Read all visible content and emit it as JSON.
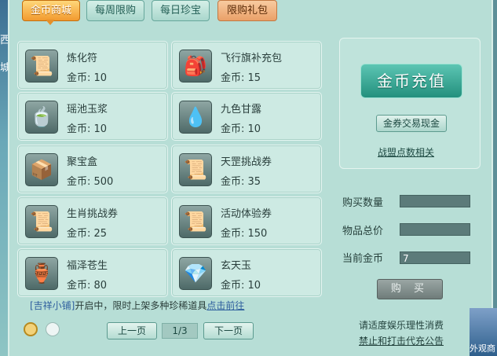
{
  "left_edge_text": [
    "西",
    "城"
  ],
  "tabs": [
    {
      "label": "金币商城",
      "active": true
    },
    {
      "label": "每周限购",
      "active": false
    },
    {
      "label": "每日珍宝",
      "active": false
    },
    {
      "label": "限购礼包",
      "active": false
    }
  ],
  "items": [
    {
      "name": "炼化符",
      "price": "金币: 10",
      "icon": "talisman-icon"
    },
    {
      "name": "飞行旗补充包",
      "price": "金币: 15",
      "icon": "flag-pack-icon"
    },
    {
      "name": "瑶池玉浆",
      "price": "金币: 10",
      "icon": "jade-gourd-icon"
    },
    {
      "name": "九色甘露",
      "price": "金币: 10",
      "icon": "nectar-icon"
    },
    {
      "name": "聚宝盒",
      "price": "金币: 500",
      "icon": "treasure-box-icon"
    },
    {
      "name": "天罡挑战券",
      "price": "金币: 35",
      "icon": "scroll-icon"
    },
    {
      "name": "生肖挑战券",
      "price": "金币: 25",
      "icon": "scroll-icon"
    },
    {
      "name": "活动体验券",
      "price": "金币: 150",
      "icon": "scroll-icon"
    },
    {
      "name": "福泽苍生",
      "price": "金币: 80",
      "icon": "bottle-icon"
    },
    {
      "name": "玄天玉",
      "price": "金币: 10",
      "icon": "jade-gem-icon"
    }
  ],
  "right": {
    "recharge_label": "金币充值",
    "exchange_label": "金券交易现金",
    "alliance_label": "战盟点数相关",
    "qty_label": "购买数量",
    "qty_value": "",
    "total_label": "物品总价",
    "total_value": "",
    "balance_label": "当前金币",
    "balance_value": "7",
    "buy_label": "购 买"
  },
  "promo": {
    "prefix": "[吉祥小铺]",
    "text": "开启中，限时上架多种珍稀道具",
    "link": "点击前往"
  },
  "pager": {
    "prev": "上一页",
    "page": "1/3",
    "next": "下一页"
  },
  "notices": [
    "请适度娱乐理性消费",
    "禁止和打击代充公告"
  ],
  "corner_label": "外观商",
  "colors": {
    "panel": "#b7ded6",
    "active_tab": "#f29a2e",
    "recharge": "#23907d",
    "link": "#2f5f9e"
  }
}
